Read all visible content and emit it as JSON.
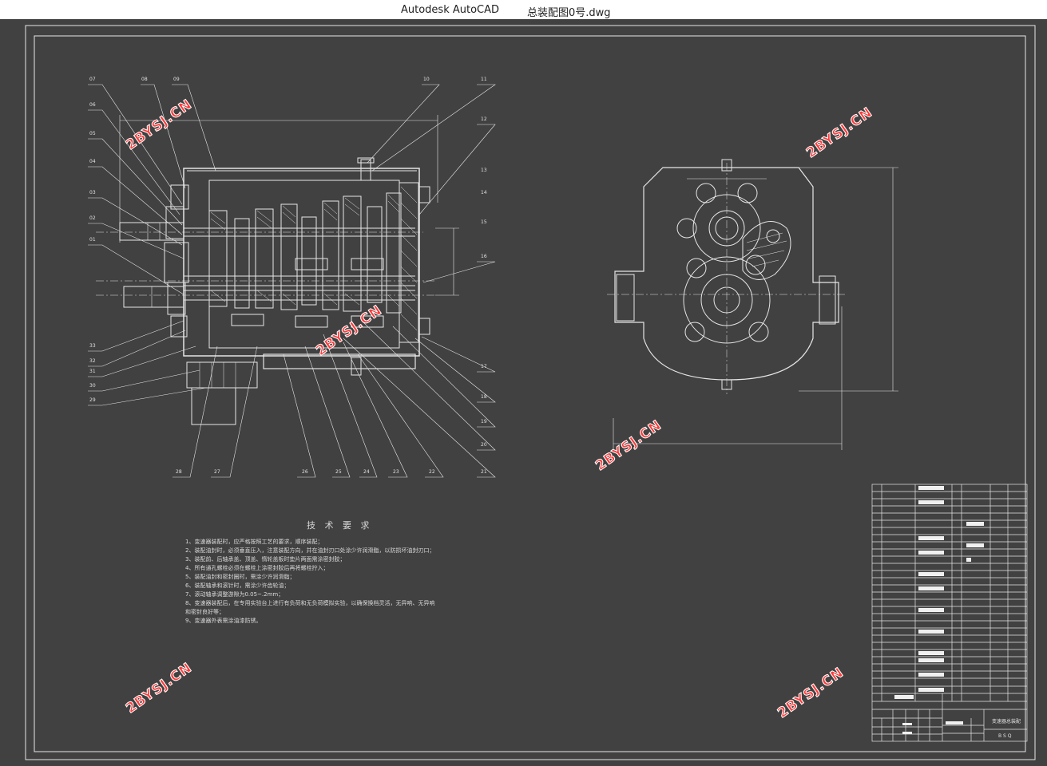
{
  "window": {
    "app_name": "Autodesk AutoCAD",
    "document_name": "总装配图0号.dwg"
  },
  "drawing": {
    "part_numbers_left": [
      "07",
      "06",
      "05",
      "04",
      "03",
      "02",
      "01",
      "33",
      "32",
      "31",
      "30",
      "29"
    ],
    "part_numbers_top": [
      "08",
      "09",
      "10",
      "11",
      "12"
    ],
    "part_numbers_right": [
      "13",
      "14",
      "15",
      "16",
      "17",
      "18",
      "19",
      "20",
      "21"
    ],
    "part_numbers_bottom": [
      "28",
      "27",
      "26",
      "25",
      "24",
      "23",
      "22"
    ],
    "technical_requirements": {
      "title": "技 术 要 求",
      "lines": [
        "1、变速器装配时，应严格按照工艺的要求，顺序装配；",
        "2、装配油封时，必须垂直压入，注意装配方向，并在油封刃口处涂少许润滑脂，以防损坏油封刃口；",
        "3、装配前、后轴承盖、顶盖、惰轮盖板时垫片两面需涂密封胶；",
        "4、所有通孔螺栓必须在螺栓上涂密封胶后再将螺栓拧入；",
        "5、装配油封和密封圈时，需涂少许润滑脂；",
        "6、装配轴承和滚针时，需涂少许齿轮油；",
        "7、滚动轴承调整游隙为0.05~.2mm；",
        "8、变速器装配后，在专用实验台上进行有负荷和无负荷模拟实验，以确保换档灵活，无异响、无异响",
        "   和密封良好等；",
        "9、变速器外表需涂油漆防锈。"
      ]
    },
    "watermark_text": "2BYSJ.CN",
    "title_block": {
      "drawing_title": "变速器总装配",
      "code": "B S Q"
    }
  }
}
